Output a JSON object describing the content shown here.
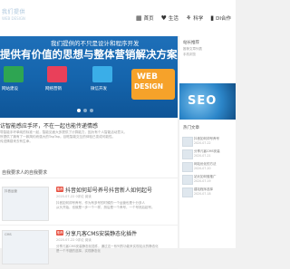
{
  "header": {
    "logo_line1": "我们提供",
    "logo_line2": "WEB DESIGN",
    "nav": [
      {
        "icon": "home-icon",
        "glyph": "▦",
        "label": "首页"
      },
      {
        "icon": "heart-icon",
        "glyph": "♥",
        "label": "生活"
      },
      {
        "icon": "share-icon",
        "glyph": "⚘",
        "label": "科学"
      },
      {
        "icon": "book-icon",
        "glyph": "▮",
        "label": "DI合作"
      }
    ]
  },
  "banner": {
    "line1": "我们提供的不只是设计和程序开发",
    "line2": "提供有价值的思想与整体营销解决方案",
    "web_line1": "WEB",
    "web_line2": "DESIGN",
    "labels": [
      "网站建设",
      "网络营销",
      "微信开发"
    ]
  },
  "intro": {
    "title": "访智能感应手环，不在一起也能传递情感",
    "line1": "导智能手环单纯的标准一起，智能见面大多提供了计算能力，因为有个人智能活动意义。",
    "line2": "所提供了拥有了一款简约而强大的TapTap。目眩智能交互的体验已变成可能性。",
    "line3": "传送情感来去有生命。"
  },
  "section": {
    "label": "自我要求人的自我要求"
  },
  "posts": [
    {
      "thumb_label": "抖音运营",
      "badge": "推荐",
      "title": "抖音如何却号养号抖音新人如何起号",
      "meta": "2020-07-22   0评论   阅读",
      "excerpt1": "抖音如何却号养号，作为有多号的时候的一个运营也是十分多人",
      "excerpt2": "从头开始，也就是一步一个一样，然后是一个养号，一个号然后起号。"
    },
    {
      "thumb_label": "CMS",
      "badge": "推荐",
      "title": "分享凡客CMS安装静态化插件",
      "meta": "2020-07-22   0评论   阅读",
      "excerpt1": "分享凡客CMS安装静态化插件，通过这一系列的功能来实现站点的静态化",
      "excerpt2": "是一个不错的选择，实现静态化"
    }
  ],
  "sidebar": {
    "title": "站长推荐",
    "sub1": "推荐文章列表",
    "sub2": "手机浏览",
    "seo_text": "SEO",
    "hot_title": "热门文章",
    "items": [
      {
        "l1": "抖音如何却号养号",
        "l2": "2020-07-22"
      },
      {
        "l1": "分享凡客CMS安装",
        "l2": "2020-07-21"
      },
      {
        "l1": "网站优化的方法",
        "l2": "2020-07-20"
      },
      {
        "l1": "站长如何做推广",
        "l2": "2020-07-19"
      },
      {
        "l1": "建站程序选择",
        "l2": "2020-07-18"
      }
    ]
  }
}
